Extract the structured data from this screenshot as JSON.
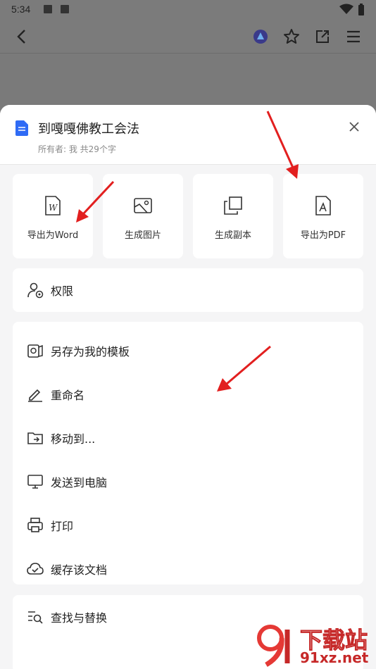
{
  "status_bar": {
    "time": "5:34"
  },
  "doc": {
    "title": "到嘎嘎佛教工会法",
    "meta": "所有者: 我   共29个字"
  },
  "actions": [
    {
      "label": "导出为Word",
      "icon": "word-icon"
    },
    {
      "label": "生成图片",
      "icon": "image-icon"
    },
    {
      "label": "生成副本",
      "icon": "copy-icon"
    },
    {
      "label": "导出为PDF",
      "icon": "pdf-icon"
    }
  ],
  "permission": {
    "label": "权限",
    "icon": "user-permission-icon"
  },
  "menu": [
    {
      "label": "另存为我的模板",
      "icon": "template-icon"
    },
    {
      "label": "重命名",
      "icon": "pencil-icon"
    },
    {
      "label": "移动到...",
      "icon": "folder-move-icon"
    },
    {
      "label": "发送到电脑",
      "icon": "monitor-icon"
    },
    {
      "label": "打印",
      "icon": "printer-icon"
    },
    {
      "label": "缓存该文档",
      "icon": "cloud-check-icon"
    }
  ],
  "find_replace": {
    "label": "查找与替换",
    "icon": "find-replace-icon"
  },
  "watermark": {
    "brand": "下载站",
    "site": "91xz.net"
  },
  "colors": {
    "accent": "#2f6bf5",
    "annotation_arrow": "#e21f1f",
    "dim_overlay": "#7a7a7a"
  }
}
